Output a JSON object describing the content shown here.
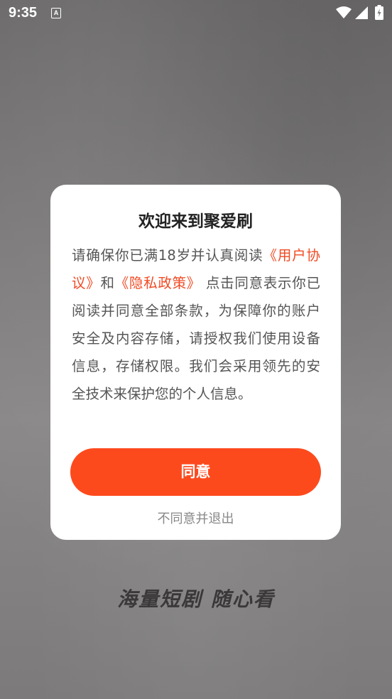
{
  "status_bar": {
    "time": "9:35",
    "notification_icon": "text-a-icon",
    "notification_letter": "A",
    "icons": [
      "wifi-icon",
      "signal-icon",
      "battery-icon"
    ]
  },
  "dialog": {
    "title": "欢迎来到聚爱刷",
    "body_prefix": "请确保你已满18岁并认真阅读",
    "user_agreement_link": "《用户协议》",
    "conjunction": "和",
    "privacy_policy_link": "《隐私政策》",
    "body_suffix": " 点击同意表示你已阅读并同意全部条款，为保障你的账户安全及内容存储，请授权我们使用设备信息，存储权限。我们会采用领先的安全技术来保护您的个人信息。",
    "agree_label": "同意",
    "decline_label": "不同意并退出"
  },
  "slogan": "海量短剧  随心看",
  "colors": {
    "accent": "#fd4a1d",
    "link": "#f14a23"
  }
}
